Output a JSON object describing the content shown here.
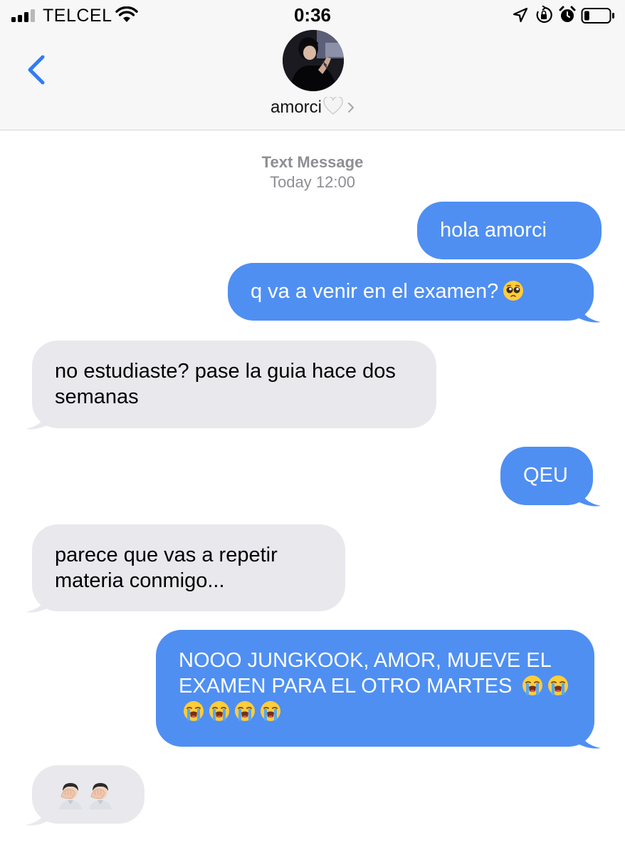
{
  "status_bar": {
    "carrier": "TELCEL",
    "time": "0:36",
    "signal_bars_active": 3,
    "signal_bars_total": 4,
    "battery_level": 0.2,
    "icons": [
      "signal-icon",
      "wifi-icon",
      "location-arrow-icon",
      "rotation-lock-icon",
      "alarm-icon",
      "battery-icon"
    ]
  },
  "header": {
    "contact_name": "amorci",
    "icons": [
      "back-chevron-icon",
      "white-heart-icon",
      "chevron-right-icon"
    ]
  },
  "conversation": {
    "service": "Text Message",
    "timestamp": "Today 12:00",
    "messages": [
      {
        "from": "me",
        "text": "hola amorci"
      },
      {
        "from": "me",
        "text": "q va a venir en el examen?",
        "emoji": [
          "pleading-face-icon"
        ]
      },
      {
        "from": "them",
        "text": "no estudiaste? pase la guia hace dos semanas"
      },
      {
        "from": "me",
        "text": "QEU"
      },
      {
        "from": "them",
        "text": "parece que vas a repetir materia conmigo..."
      },
      {
        "from": "me",
        "text": "NOOO JUNGKOOK, AMOR, MUEVE EL EXAMEN PARA EL OTRO MARTES",
        "emoji": [
          "loudly-crying-face-icon",
          "loudly-crying-face-icon",
          "loudly-crying-face-icon",
          "loudly-crying-face-icon",
          "loudly-crying-face-icon",
          "loudly-crying-face-icon"
        ]
      },
      {
        "from": "them",
        "text": "",
        "emoji": [
          "facepalm-icon",
          "facepalm-icon"
        ]
      }
    ]
  },
  "colors": {
    "outgoing_bubble": "#4f8ff2",
    "incoming_bubble": "#e8e8ed",
    "accent": "#2f7cf6",
    "meta_text": "#8e8e93"
  }
}
